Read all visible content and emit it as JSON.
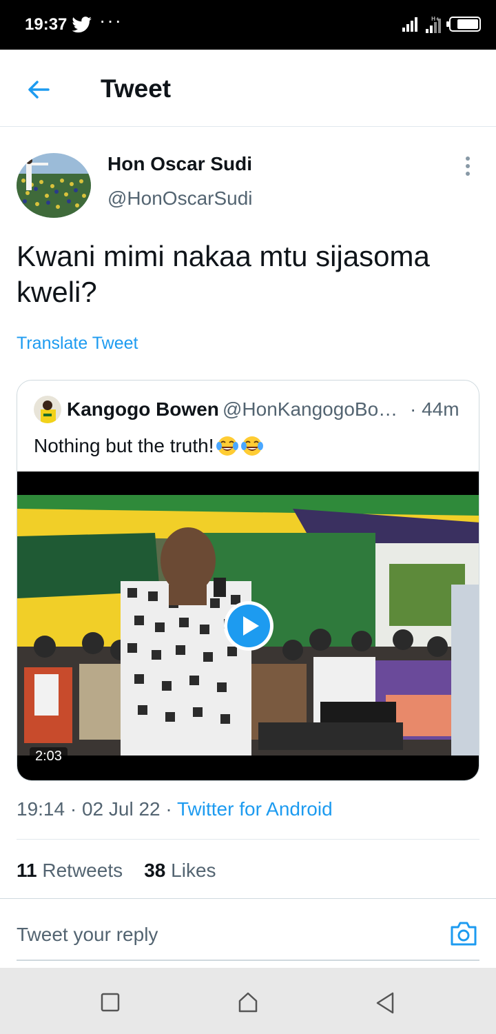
{
  "status_bar": {
    "time": "19:37",
    "dots": "···",
    "icons": [
      "twitter-icon",
      "signal-icon",
      "signal-icon-2",
      "battery-icon"
    ]
  },
  "header": {
    "title": "Tweet",
    "back_icon": "arrow-left-icon"
  },
  "tweet": {
    "author_name": "Hon Oscar Sudi",
    "author_handle": "@HonOscarSudi",
    "text": "Kwani mimi nakaa mtu sijasoma kweli?",
    "translate_label": "Translate Tweet",
    "quoted": {
      "name": "Kangogo Bowen",
      "handle": "@HonKangogoBowen",
      "time": "· 44m",
      "text": "Nothing but the truth!",
      "emoji": [
        "face-with-tears-of-joy",
        "face-with-tears-of-joy"
      ],
      "video_duration": "2:03"
    },
    "time": "19:14",
    "separator": "·",
    "date": "02 Jul 22",
    "source": "Twitter for Android",
    "retweets_count": "11",
    "retweets_label": "Retweets",
    "likes_count": "38",
    "likes_label": "Likes"
  },
  "reply": {
    "placeholder": "Tweet your reply"
  },
  "colors": {
    "accent": "#1d9bf0",
    "text_primary": "#0f1419",
    "text_secondary": "#536471",
    "border": "#cfd9de"
  }
}
